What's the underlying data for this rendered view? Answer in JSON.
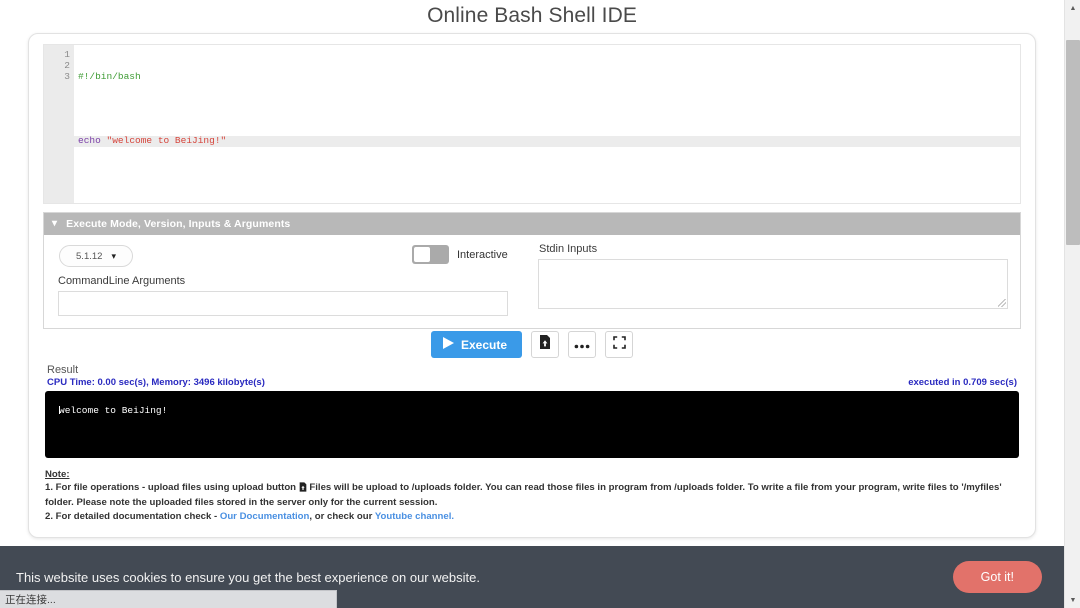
{
  "page": {
    "title": "Online Bash Shell IDE"
  },
  "editor": {
    "line_numbers": [
      "1",
      "2",
      "3"
    ],
    "lines": [
      {
        "text": "#!/bin/bash",
        "type": "comment"
      },
      {
        "text": "",
        "type": "blank"
      },
      {
        "text": "echo \"welcome to BeiJing!\"",
        "type": "code",
        "keyword": "echo",
        "string": "\"welcome to BeiJing!\""
      }
    ]
  },
  "exec_panel": {
    "header": "Execute Mode, Version, Inputs & Arguments",
    "chevron_icon": "chevron-down-icon",
    "version_value": "5.1.12",
    "version_chevron_icon": "chevron-down-icon",
    "interactive_label": "Interactive",
    "interactive_on": false,
    "cmdline_label": "CommandLine Arguments",
    "cmdline_value": "",
    "cmdline_placeholder": "",
    "stdin_label": "Stdin Inputs",
    "stdin_value": "",
    "stdin_placeholder": ""
  },
  "actions": {
    "execute_label": "Execute",
    "execute_icon": "play-icon",
    "upload_icon": "file-upload-icon",
    "more_icon": "ellipsis-icon",
    "fullscreen_icon": "fullscreen-icon"
  },
  "result": {
    "title": "Result",
    "cpu_meta": "CPU Time: 0.00 sec(s), Memory: 3496 kilobyte(s)",
    "exec_time": "executed in 0.709 sec(s)",
    "console_output": "welcome to BeiJing!"
  },
  "note": {
    "heading": "Note:",
    "line1_a": "1. For file operations - upload files using upload button",
    "line1_icon": "file-upload-icon",
    "line1_b": "Files will be upload to /uploads folder. You can read those files in program from /uploads folder. To write a file from your program, write files to '/myfiles' folder. Please note the uploaded files stored in the server only for the current session.",
    "line2_a": "2. For detailed documentation check - ",
    "line2_link1": "Our Documentation",
    "line2_mid": ", or check our ",
    "line2_link2": "Youtube channel."
  },
  "cookie_banner": {
    "message": "This website uses cookies to ensure you get the best experience on our website.",
    "button_label": "Got it!"
  },
  "status_bar": {
    "text": "正在连接..."
  },
  "scrollbar": {
    "up_icon": "scroll-up-arrow-icon",
    "down_icon": "scroll-down-arrow-icon"
  },
  "colors": {
    "accent_blue": "#3a9ae8",
    "meta_blue": "#2a2ac0",
    "link_blue": "#4a90e2",
    "banner_bg": "#434a54",
    "gotit_red": "#e2726a",
    "panel_header_gray": "#b8b8b8",
    "console_bg": "#000000"
  }
}
